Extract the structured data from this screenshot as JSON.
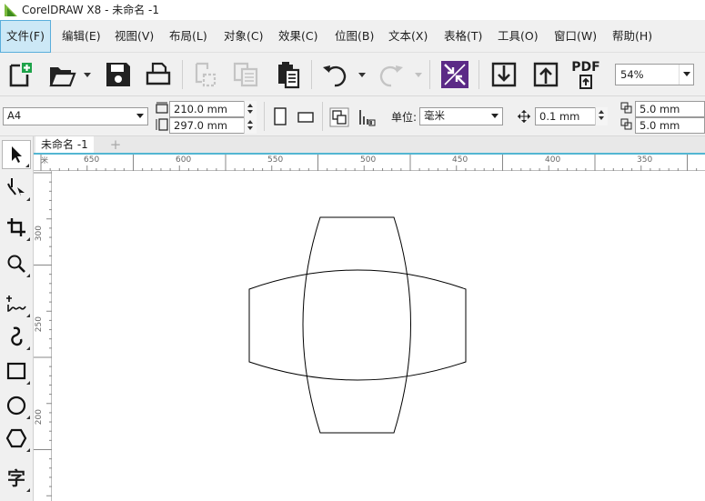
{
  "window": {
    "title": "CorelDRAW X8 - 未命名 -1"
  },
  "menu": [
    {
      "label": "文件(F)",
      "active": true
    },
    {
      "label": "编辑(E)"
    },
    {
      "label": "视图(V)"
    },
    {
      "label": "布局(L)"
    },
    {
      "label": "对象(C)"
    },
    {
      "label": "效果(C)"
    },
    {
      "label": "位图(B)"
    },
    {
      "label": "文本(X)"
    },
    {
      "label": "表格(T)"
    },
    {
      "label": "工具(O)"
    },
    {
      "label": "窗口(W)"
    },
    {
      "label": "帮助(H)"
    }
  ],
  "toolbar": {
    "pdf_label": "PDF",
    "zoom_value": "54%",
    "icons": [
      "new-document-icon",
      "open-icon",
      "save-icon",
      "print-icon",
      "cut-icon",
      "copy-icon",
      "paste-icon",
      "undo-icon",
      "redo-icon",
      "quick-customize-icon",
      "import-icon",
      "export-icon",
      "publish-pdf-icon"
    ]
  },
  "property_bar": {
    "page_size": "A4",
    "width": "210.0 mm",
    "height": "297.0 mm",
    "units_label": "单位:",
    "units_value": "毫米",
    "nudge": "0.1 mm",
    "dup_x": "5.0 mm",
    "dup_y": "5.0 mm"
  },
  "toolbox": {
    "icons": [
      "pick-tool-icon",
      "shape-tool-icon",
      "crop-tool-icon",
      "zoom-tool-icon",
      "freehand-tool-icon",
      "artistic-media-tool-icon",
      "rectangle-tool-icon",
      "ellipse-tool-icon",
      "polygon-tool-icon",
      "text-tool-icon"
    ],
    "text_tool_glyph": "字"
  },
  "document": {
    "tab_label": "未命名 -1",
    "add_tab": "+"
  },
  "rulers": {
    "h_labels": [
      "650",
      "600",
      "550",
      "500",
      "450",
      "400",
      "350"
    ],
    "v_labels": [
      "300",
      "250",
      "200"
    ],
    "corner": "米"
  },
  "colors": {
    "accent": "#53b6d2",
    "menu_active_bg": "#cce8f6",
    "logo_green": "#7dbb3f",
    "quick_customize_bg": "#5b2a86"
  }
}
